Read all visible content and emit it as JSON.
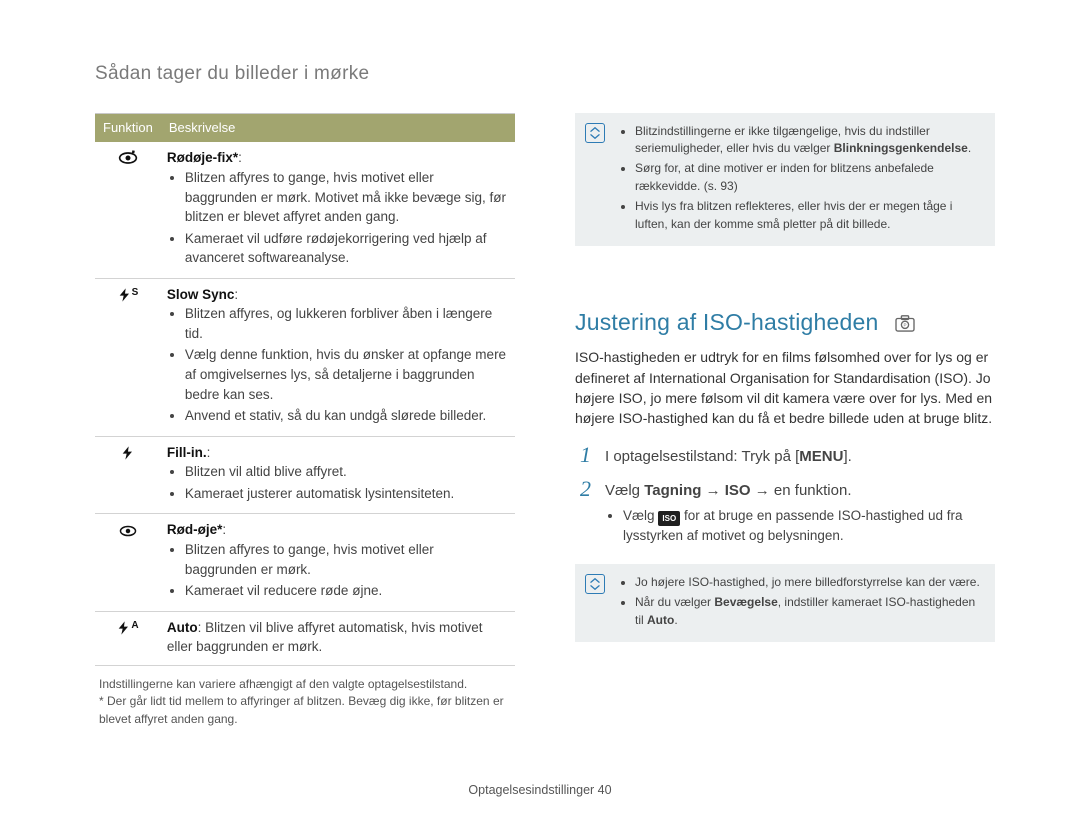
{
  "page_heading": "Sådan tager du billeder i mørke",
  "table": {
    "col1": "Funktion",
    "col2": "Beskrivelse",
    "rows": [
      {
        "icon_name": "redeye-fix-icon",
        "title": "Rødøje-fix*",
        "colon": ":",
        "items": [
          "Blitzen affyres to gange, hvis motivet eller baggrunden er mørk. Motivet må ikke bevæge sig, før blitzen er blevet affyret anden gang.",
          "Kameraet vil udføre rødøjekorrigering ved hjælp af avanceret softwareanalyse."
        ]
      },
      {
        "icon_name": "slow-sync-icon",
        "title": "Slow Sync",
        "colon": ":",
        "items": [
          "Blitzen affyres, og lukkeren forbliver åben i længere tid.",
          "Vælg denne funktion, hvis du ønsker at opfange mere af omgivelsernes lys, så detaljerne i baggrunden bedre kan ses.",
          "Anvend et stativ, så du kan undgå slørede billeder."
        ]
      },
      {
        "icon_name": "fill-in-icon",
        "title": "Fill-in.",
        "colon": ":",
        "items": [
          "Blitzen vil altid blive affyret.",
          "Kameraet justerer automatisk lysintensiteten."
        ]
      },
      {
        "icon_name": "red-eye-icon",
        "title": "Rød-øje*",
        "colon": ":",
        "items": [
          "Blitzen affyres to gange, hvis motivet eller baggrunden er mørk.",
          "Kameraet vil reducere røde øjne."
        ]
      },
      {
        "icon_name": "auto-flash-icon",
        "inline_title": "Auto",
        "inline_text": ": Blitzen vil blive affyret automatisk, hvis motivet eller baggrunden er mørk."
      }
    ]
  },
  "foot1": "Indstillingerne kan variere afhængigt af den valgte optagelsestilstand.",
  "foot2": "* Der går lidt tid mellem to affyringer af blitzen. Bevæg dig ikke, før blitzen er blevet affyret anden gang.",
  "callout1": {
    "items": [
      {
        "pre": "Blitzindstillingerne er ikke tilgængelige, hvis du indstiller seriemuligheder, eller hvis du vælger ",
        "bold": "Blinkningsgenkendelse",
        "post": "."
      },
      {
        "pre": "Sørg for, at dine motiver er inden for blitzens anbefalede rækkevidde. (s. 93)"
      },
      {
        "pre": "Hvis lys fra blitzen reflekteres, eller hvis der er megen tåge i luften, kan der komme små pletter på dit billede."
      }
    ]
  },
  "section2": {
    "title": "Justering af ISO-hastigheden",
    "para": "ISO-hastigheden er udtryk for en films følsomhed over for lys og er defineret af International Organisation for Standardisation (ISO). Jo højere ISO, jo mere følsom vil dit kamera være over for lys. Med en højere ISO-hastighed kan du få et bedre billede uden at bruge blitz.",
    "step1_pre": "I optagelsestilstand: Tryk på [",
    "step1_key": "MENU",
    "step1_post": "].",
    "step2_a": "Vælg ",
    "step2_b": "Tagning",
    "step2_c": " → ",
    "step2_d": "ISO",
    "step2_e": " → en funktion.",
    "step2_sub_a": "Vælg ",
    "step2_sub_b": " for at bruge en passende ISO-hastighed ud fra lysstyrken af motivet og belysningen."
  },
  "callout2": {
    "item1": "Jo højere ISO-hastighed, jo mere billedforstyrrelse kan der være.",
    "item2_a": "Når du vælger ",
    "item2_b": "Bevægelse",
    "item2_c": ", indstiller kameraet ISO-hastigheden til ",
    "item2_d": "Auto",
    "item2_e": "."
  },
  "footer": "Optagelsesindstillinger  40"
}
